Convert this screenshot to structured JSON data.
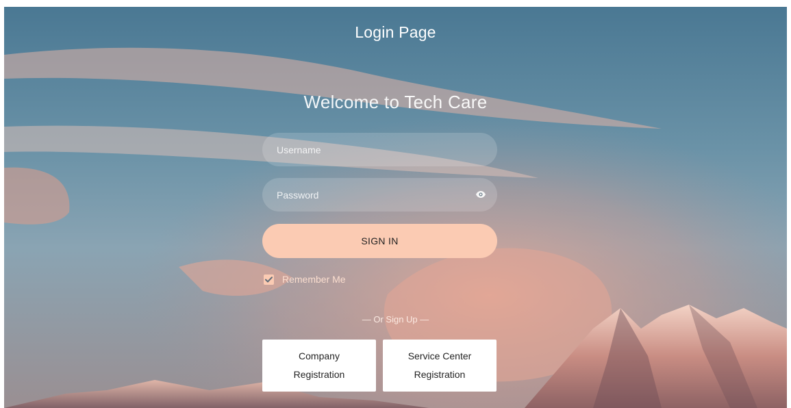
{
  "header": {
    "title": "Login Page"
  },
  "form": {
    "welcome": "Welcome to Tech Care",
    "username": {
      "placeholder": "Username",
      "value": ""
    },
    "password": {
      "placeholder": "Password",
      "value": "",
      "toggle_icon": "eye-icon"
    },
    "signin_label": "SIGN IN",
    "remember": {
      "label": "Remember Me",
      "checked": true
    },
    "or_signup": "— Or Sign Up —"
  },
  "registration": {
    "company": {
      "line1": "Company",
      "line2": "Registration"
    },
    "service_center": {
      "line1": "Service Center",
      "line2": "Registration"
    }
  },
  "colors": {
    "accent": "#fbcbb3",
    "sky_top": "#4d7b95",
    "sky_mid": "#6f97ab",
    "cloud_pink": "#d9a18f"
  }
}
